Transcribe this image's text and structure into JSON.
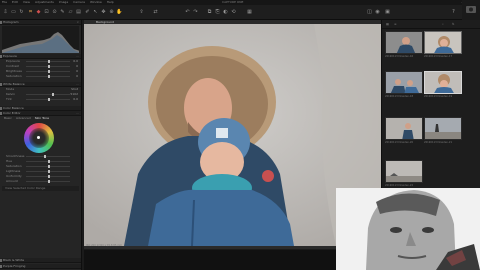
{
  "menu": {
    "items": [
      "File",
      "Edit",
      "View",
      "Adjustments",
      "Image",
      "Camera",
      "Window",
      "Help"
    ],
    "app_title": "CAPTURE ONE"
  },
  "toolbar": {
    "icons": [
      "import-icon",
      "folder-icon",
      "rotate-icon",
      "crop-icon",
      "straighten-icon",
      "keystone-icon",
      "spot-icon",
      "brush-icon",
      "eraser-icon",
      "gradient-icon",
      "picker-icon",
      "cursor-icon",
      "move-icon",
      "zoom-icon",
      "export-icon",
      "share-icon",
      "undo-icon",
      "redo-icon",
      "copy-icon",
      "paste-icon",
      "reset-icon",
      "help-icon"
    ]
  },
  "left_panel": {
    "sections": [
      {
        "title": "Histogram"
      },
      {
        "title": "Exposure"
      },
      {
        "title": "White Balance"
      },
      {
        "title": "Color Balance"
      },
      {
        "title": "Color Editor"
      },
      {
        "title": "Black & White"
      },
      {
        "title": "Purple Fringing"
      }
    ],
    "exposure_rows": [
      {
        "label": "Exposure",
        "value": "0.0",
        "pos": 0.5
      },
      {
        "label": "Contrast",
        "value": "0",
        "pos": 0.5
      },
      {
        "label": "Brightness",
        "value": "0",
        "pos": 0.5
      },
      {
        "label": "Saturation",
        "value": "0",
        "pos": 0.5
      }
    ],
    "wb_rows": [
      {
        "label": "Mode",
        "value": "Shot"
      },
      {
        "label": "Kelvin",
        "value": "5102"
      },
      {
        "label": "Tint",
        "value": "0.0"
      }
    ],
    "color_editor_tabs": [
      "Basic",
      "Advanced",
      "Skin Tone"
    ],
    "color_rows": [
      {
        "label": "Smoothness"
      },
      {
        "label": "Hue"
      },
      {
        "label": "Saturation"
      },
      {
        "label": "Lightness"
      },
      {
        "label": "Uniformity"
      },
      {
        "label": "Amount"
      }
    ],
    "bottom_note": "View Selected Color Range"
  },
  "viewer": {
    "title": "Background"
  },
  "status": {
    "text": "ISO 200 1/320 s f/2.8 85 mm"
  },
  "browser": {
    "thumbs": [
      {
        "label": "20190113 Dresden-16"
      },
      {
        "label": "20190113 Dresden-17"
      },
      {
        "label": "20190113 Dresden-18"
      },
      {
        "label": "20190113 Dresden-19"
      },
      {
        "label": "20190113 Dresden-20"
      },
      {
        "label": "20190113 Dresden-21"
      },
      {
        "label": "20190113 Dresden-22"
      }
    ]
  },
  "colors": {
    "accent": "#e0a050",
    "panel_bg": "#252525",
    "jacket_blue": "#2f4a66",
    "scarf": "#3a9fb0"
  }
}
